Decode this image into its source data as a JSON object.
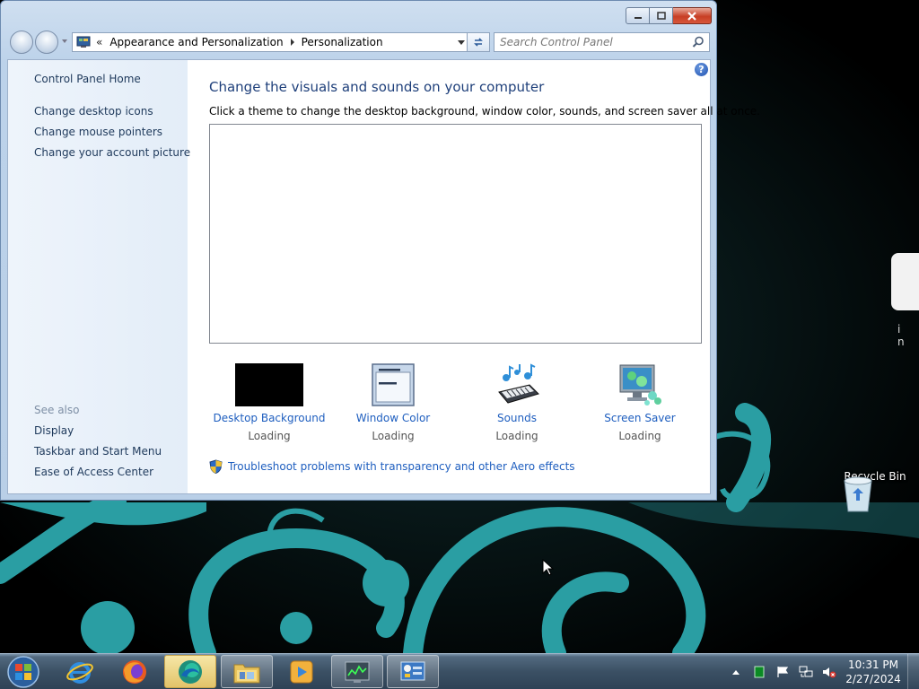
{
  "window": {
    "address": {
      "overflow": "«",
      "crumbs": [
        "Appearance and Personalization",
        "Personalization"
      ]
    },
    "search_placeholder": "Search Control Panel",
    "left_pane": {
      "home": "Control Panel Home",
      "tasks": [
        "Change desktop icons",
        "Change mouse pointers",
        "Change your account picture"
      ],
      "see_also_label": "See also",
      "see_also": [
        "Display",
        "Taskbar and Start Menu",
        "Ease of Access Center"
      ]
    },
    "main": {
      "heading": "Change the visuals and sounds on your computer",
      "subtext": "Click a theme to change the desktop background, window color, sounds, and screen saver all at once.",
      "options": [
        {
          "label": "Desktop Background",
          "status": "Loading",
          "icon": "desktop-background-icon"
        },
        {
          "label": "Window Color",
          "status": "Loading",
          "icon": "window-color-icon"
        },
        {
          "label": "Sounds",
          "status": "Loading",
          "icon": "sounds-icon"
        },
        {
          "label": "Screen Saver",
          "status": "Loading",
          "icon": "screen-saver-icon"
        }
      ],
      "troubleshoot": "Troubleshoot problems with transparency and other Aero effects"
    },
    "help_glyph": "?"
  },
  "desktop": {
    "recycle_bin": "Recycle Bin"
  },
  "taskbar": {
    "pinned": [
      "internet-explorer-icon",
      "firefox-icon",
      "edge-icon",
      "file-explorer-icon",
      "media-player-icon",
      "task-manager-icon",
      "control-panel-icon"
    ],
    "clock": {
      "time": "10:31 PM",
      "date": "2/27/2024"
    }
  },
  "colors": {
    "link": "#1e5ebf",
    "heading": "#1e3f7a",
    "wallpaper_accent": "#2a9ea3"
  }
}
